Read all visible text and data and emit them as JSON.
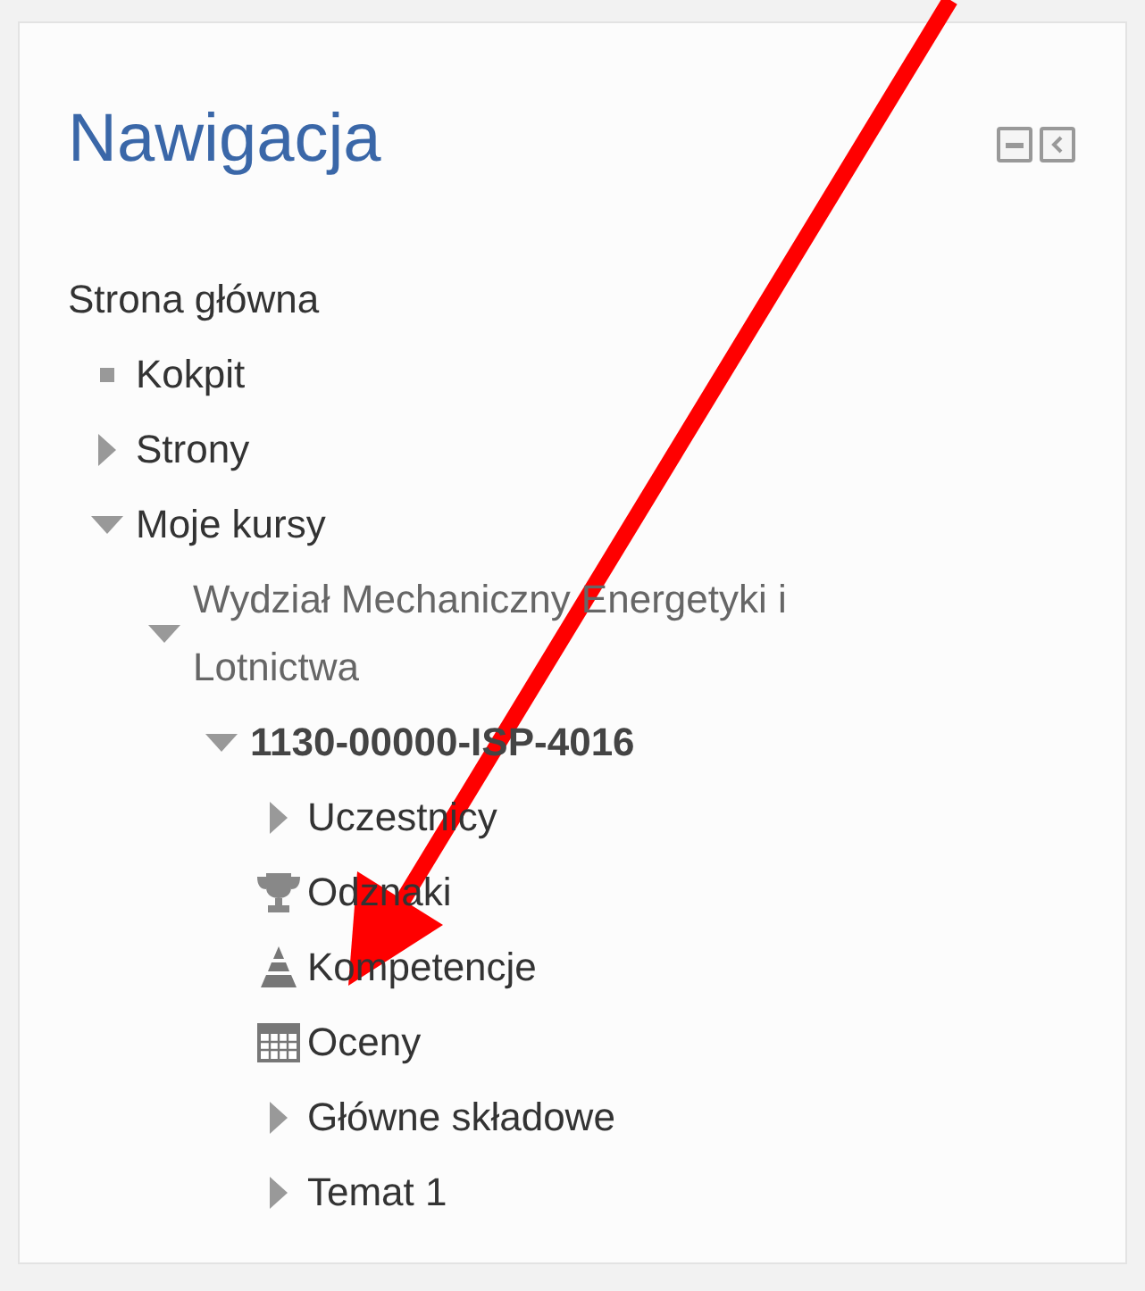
{
  "block": {
    "title": "Nawigacja"
  },
  "tree": [
    {
      "label": "Strona główna",
      "kind": "plain",
      "children": [
        {
          "label": "Kokpit",
          "kind": "bullet"
        },
        {
          "label": "Strony",
          "kind": "branch",
          "expanded": false
        },
        {
          "label": "Moje kursy",
          "kind": "branch",
          "expanded": true,
          "children": [
            {
              "label": "Wydział Mechaniczny Energetyki i Lotnictwa",
              "kind": "branch",
              "expanded": true,
              "children": [
                {
                  "label": "1130-00000-ISP-4016",
                  "kind": "course",
                  "expanded": true,
                  "children": [
                    {
                      "label": "Uczestnicy",
                      "kind": "branch",
                      "expanded": false
                    },
                    {
                      "label": "Odznaki",
                      "kind": "trophy"
                    },
                    {
                      "label": "Kompetencje",
                      "kind": "pyramid"
                    },
                    {
                      "label": "Oceny",
                      "kind": "grades"
                    },
                    {
                      "label": "Główne składowe",
                      "kind": "branch",
                      "expanded": false
                    },
                    {
                      "label": "Temat 1",
                      "kind": "branch",
                      "expanded": false
                    }
                  ]
                }
              ]
            }
          ]
        }
      ]
    }
  ]
}
